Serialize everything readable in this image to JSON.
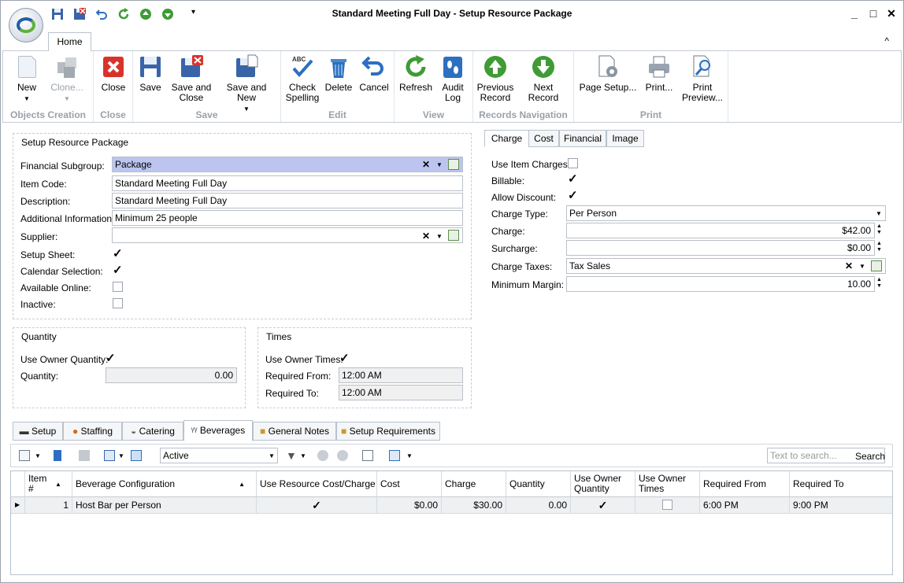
{
  "window": {
    "title": "Standard Meeting Full Day - Setup Resource Package",
    "min": "▁",
    "max": "□",
    "close": "✕"
  },
  "ribbon": {
    "home_tab": "Home",
    "groups": {
      "objects": "Objects Creation",
      "close": "Close",
      "save": "Save",
      "edit": "Edit",
      "view": "View",
      "nav": "Records Navigation",
      "print": "Print"
    },
    "new": "New",
    "clone": "Clone...",
    "close": "Close",
    "save": "Save",
    "save_close_1": "Save and",
    "save_close_2": "Close",
    "save_new": "Save and New",
    "check_1": "Check",
    "check_2": "Spelling",
    "delete": "Delete",
    "cancel": "Cancel",
    "refresh": "Refresh",
    "audit_1": "Audit",
    "audit_2": "Log",
    "prev_1": "Previous",
    "prev_2": "Record",
    "next": "Next Record",
    "page_setup": "Page Setup...",
    "print": "Print...",
    "preview_1": "Print",
    "preview_2": "Preview..."
  },
  "setup": {
    "title": "Setup Resource Package",
    "financial_subgroup_label": "Financial Subgroup:",
    "financial_subgroup": "Package",
    "item_code_label": "Item Code:",
    "item_code": "Standard Meeting Full Day",
    "description_label": "Description:",
    "description": "Standard Meeting Full Day",
    "additional_label": "Additional Information:",
    "additional": "Minimum 25 people",
    "supplier_label": "Supplier:",
    "supplier": "",
    "setup_sheet_label": "Setup Sheet:",
    "setup_sheet": true,
    "calendar_label": "Calendar Selection:",
    "calendar": true,
    "online_label": "Available Online:",
    "online": false,
    "inactive_label": "Inactive:",
    "inactive": false
  },
  "quantity": {
    "title": "Quantity",
    "use_owner_label": "Use Owner Quantity:",
    "use_owner": true,
    "quantity_label": "Quantity:",
    "quantity": "0.00"
  },
  "times": {
    "title": "Times",
    "use_owner_label": "Use Owner Times:",
    "use_owner": true,
    "from_label": "Required From:",
    "from": "12:00 AM",
    "to_label": "Required To:",
    "to": "12:00 AM"
  },
  "charge_tabs": [
    "Charge",
    "Cost",
    "Financial",
    "Image"
  ],
  "charge": {
    "use_item_label": "Use Item Charges:",
    "use_item": false,
    "billable_label": "Billable:",
    "billable": true,
    "allow_discount_label": "Allow Discount:",
    "allow_discount": true,
    "type_label": "Charge Type:",
    "type": "Per Person",
    "charge_label": "Charge:",
    "charge": "$42.00",
    "surcharge_label": "Surcharge:",
    "surcharge": "$0.00",
    "taxes_label": "Charge Taxes:",
    "taxes": "Tax Sales",
    "margin_label": "Minimum Margin:",
    "margin": "10.00"
  },
  "bottom_tabs": [
    "Setup",
    "Staffing",
    "Catering",
    "Beverages",
    "General Notes",
    "Setup Requirements"
  ],
  "list_toolbar": {
    "filter": "Active",
    "search_placeholder": "Text to search...",
    "search": "Search"
  },
  "grid": {
    "headers": {
      "item": "Item #",
      "config": "Beverage Configuration",
      "use_res": "Use Resource Cost/Charge",
      "cost": "Cost",
      "charge": "Charge",
      "qty": "Quantity",
      "owner_qty": "Use Owner Quantity",
      "owner_times": "Use Owner Times",
      "from": "Required From",
      "to": "Required To"
    },
    "rows": [
      {
        "item": "1",
        "config": "Host Bar per Person",
        "use_res": true,
        "cost": "$0.00",
        "charge": "$30.00",
        "qty": "0.00",
        "owner_qty": true,
        "owner_times": false,
        "from": "6:00 PM",
        "to": "9:00 PM"
      }
    ]
  },
  "colors": {
    "accent": "#bcc4f0",
    "green": "#3f9b35",
    "red": "#d8332a",
    "blue": "#2d6fc0"
  }
}
